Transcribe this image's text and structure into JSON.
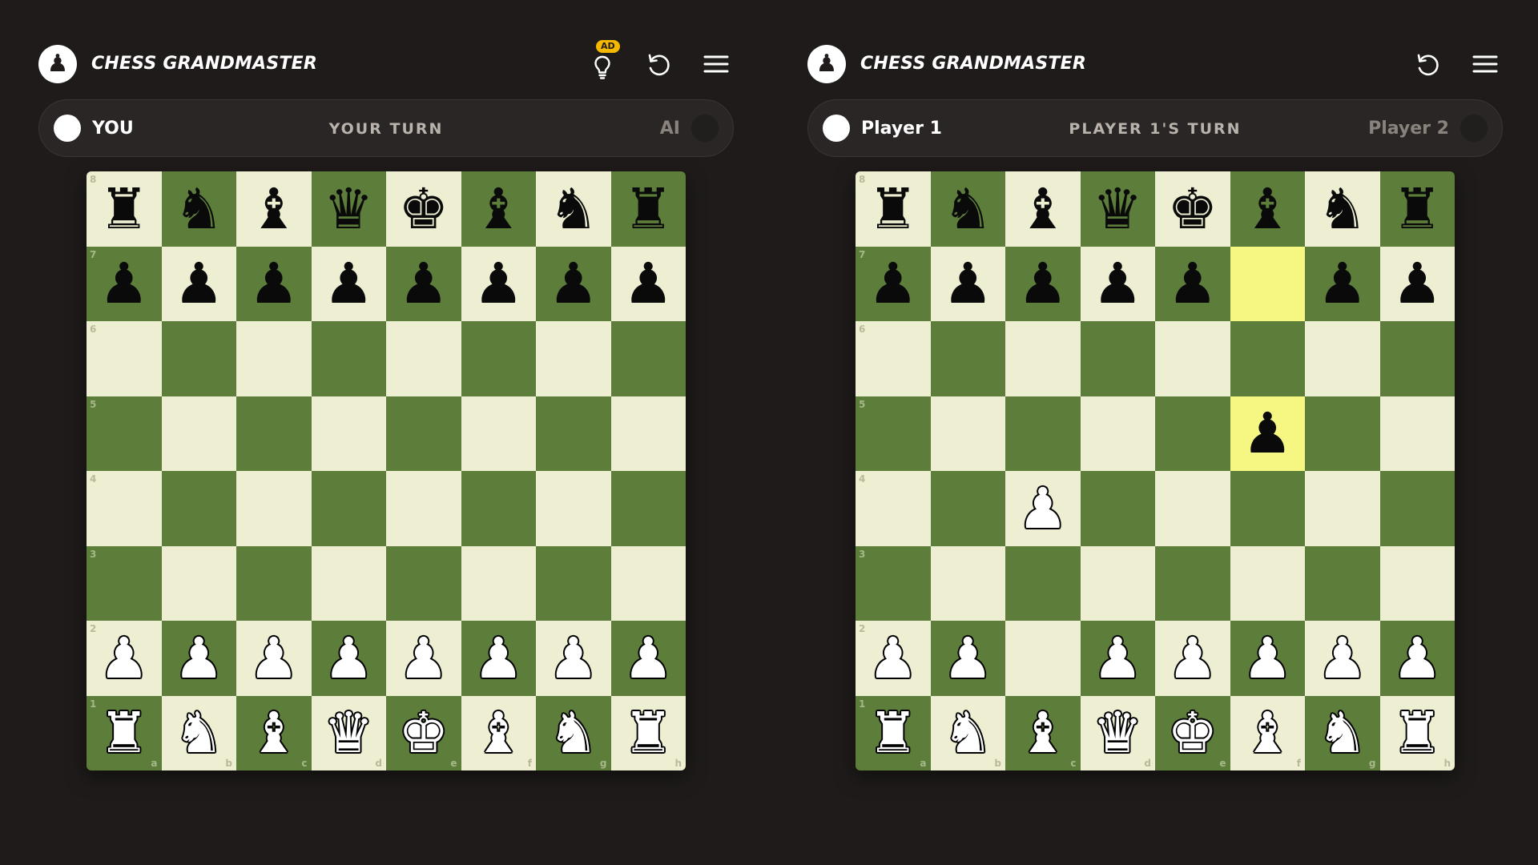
{
  "colors": {
    "background": "#1f1b1b",
    "light_square": "#eeeed2",
    "dark_square": "#5d7d3a",
    "highlight_dark": "#7a8a36",
    "ad_badge": "#f5b800"
  },
  "left": {
    "header": {
      "logo_icon": "pawn-icon",
      "logo_glyph": "♟",
      "title": "CHESS GRANDMASTER",
      "hint_badge": "AD",
      "hint_icon": "lightbulb-icon",
      "undo_icon": "undo-icon",
      "menu_icon": "menu-icon"
    },
    "status": {
      "player_left": "YOU",
      "turn": "YOUR TURN",
      "player_right": "AI"
    },
    "board": {
      "ranks": [
        [
          "r",
          "n",
          "b",
          "q",
          "k",
          "b",
          "n",
          "r"
        ],
        [
          "p",
          "p",
          "p",
          "p",
          "p",
          "p",
          "p",
          "p"
        ],
        [
          "",
          "",
          "",
          "",
          "",
          "",
          "",
          ""
        ],
        [
          "",
          "",
          "",
          "",
          "",
          "",
          "",
          ""
        ],
        [
          "",
          "",
          "",
          "",
          "",
          "",
          "",
          ""
        ],
        [
          "",
          "",
          "",
          "",
          "",
          "",
          "",
          ""
        ],
        [
          "P",
          "P",
          "P",
          "P",
          "P",
          "P",
          "P",
          "P"
        ],
        [
          "R",
          "N",
          "B",
          "Q",
          "K",
          "B",
          "N",
          "R"
        ]
      ],
      "highlights": [],
      "rank_labels": [
        "8",
        "7",
        "6",
        "5",
        "4",
        "3",
        "2",
        "1"
      ],
      "file_labels": [
        "a",
        "b",
        "c",
        "d",
        "e",
        "f",
        "g",
        "h"
      ]
    }
  },
  "right": {
    "header": {
      "logo_icon": "pawn-icon",
      "logo_glyph": "♟",
      "title": "CHESS GRANDMASTER",
      "undo_icon": "undo-icon",
      "menu_icon": "menu-icon"
    },
    "status": {
      "player_left": "Player 1",
      "turn": "PLAYER 1'S TURN",
      "player_right": "Player 2"
    },
    "board": {
      "ranks": [
        [
          "r",
          "n",
          "b",
          "q",
          "k",
          "b",
          "n",
          "r"
        ],
        [
          "p",
          "p",
          "p",
          "p",
          "p",
          "",
          "p",
          "p"
        ],
        [
          "",
          "",
          "",
          "",
          "",
          "",
          "",
          ""
        ],
        [
          "",
          "",
          "",
          "",
          "",
          "p",
          "",
          ""
        ],
        [
          "",
          "",
          "P",
          "",
          "",
          "",
          "",
          ""
        ],
        [
          "",
          "",
          "",
          "",
          "",
          "",
          "",
          ""
        ],
        [
          "P",
          "P",
          "",
          "P",
          "P",
          "P",
          "P",
          "P"
        ],
        [
          "R",
          "N",
          "B",
          "Q",
          "K",
          "B",
          "N",
          "R"
        ]
      ],
      "highlights": [
        "f7",
        "f5"
      ],
      "rank_labels": [
        "8",
        "7",
        "6",
        "5",
        "4",
        "3",
        "2",
        "1"
      ],
      "file_labels": [
        "a",
        "b",
        "c",
        "d",
        "e",
        "f",
        "g",
        "h"
      ]
    }
  }
}
